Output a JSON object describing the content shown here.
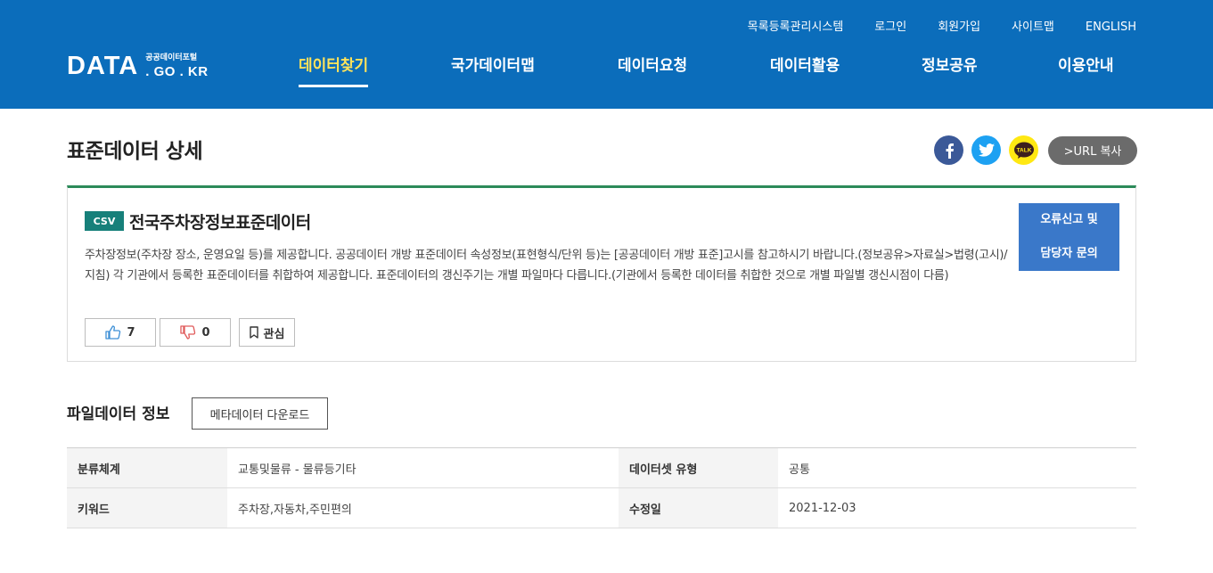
{
  "header": {
    "logo_main": "DATA",
    "logo_small": "공공데이터포털",
    "logo_domain": ". GO . KR",
    "util_links": [
      "목록등록관리시스템",
      "로그인",
      "회원가입",
      "사이트맵",
      "ENGLISH"
    ],
    "nav": [
      "데이터찾기",
      "국가데이터맵",
      "데이터요청",
      "데이터활용",
      "정보공유",
      "이용안내"
    ],
    "nav_active": "데이터찾기"
  },
  "page": {
    "title": "표준데이터 상세",
    "share": {
      "icons": [
        "facebook-icon",
        "twitter-icon",
        "kakaotalk-icon"
      ],
      "kakao_label": "TALK",
      "url_copy_label": ">URL 복사"
    }
  },
  "dataset": {
    "format": "CSV",
    "title": "전국주차장정보표준데이터",
    "description": "주차장정보(주차장 장소, 운영요일 등)를 제공합니다. 공공데이터 개방 표준데이터 속성정보(표현형식/단위 등)는 [공공데이터 개방 표준]고시를 참고하시기 바랍니다.(정보공유>자료실>법령(고시)/지침) 각 기관에서 등록한 표준데이터를 취합하여 제공합니다. 표준데이터의 갱신주기는 개별 파일마다 다릅니다.(기관에서 등록한 데이터를 취합한 것으로 개별 파일별 갱신시점이 다름)",
    "report_button": [
      "오류신고 및",
      "담당자 문의"
    ],
    "likes": "7",
    "dislikes": "0",
    "favorite_label": "관심"
  },
  "file_info": {
    "section_title": "파일데이터 정보",
    "meta_download_label": "메타데이터 다운로드",
    "rows": [
      {
        "label1": "분류체계",
        "value1": "교통및물류 - 물류등기타",
        "label2": "데이터셋 유형",
        "value2": "공통"
      },
      {
        "label1": "키워드",
        "value1": "주차장,자동차,주민편의",
        "label2": "수정일",
        "value2": "2021-12-03"
      }
    ]
  },
  "colors": {
    "header_bg": "#0b6dbb",
    "nav_active": "#ffe35a",
    "card_accent": "#2c8a59",
    "csv_badge": "#17807a",
    "report_button": "#3a78c9"
  }
}
